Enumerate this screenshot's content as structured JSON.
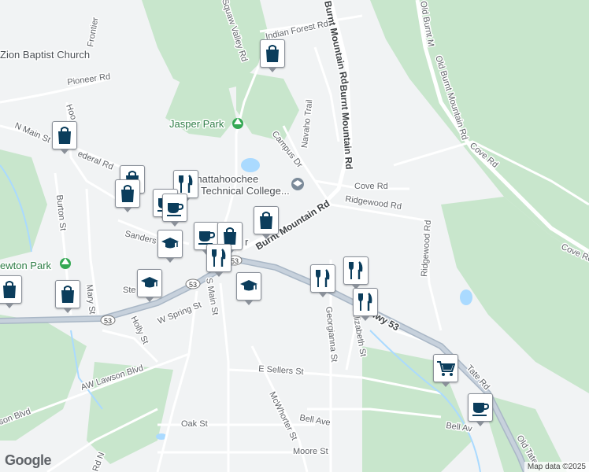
{
  "labels": {
    "church": "Zion Baptist Church",
    "jasper_park": "Jasper Park",
    "college_line1": "Chattahoochee",
    "college_line2": "Technical College...",
    "newton_park": "ewton Park",
    "frontier": "Frontier",
    "squaw_valley": "Squaw Valley Rd",
    "indian_forest": "Indian Forest Rd",
    "burnt_mtn_top": "Burnt Mountain Rd",
    "burnt_mtn_mid": "Burnt Mountain Rd",
    "burnt_mtn_diag": "Burnt Mountain Rd",
    "old_burnt_1": "Old Burnt M",
    "old_burnt_2": "Old Burnt Mountain Rd",
    "navaho": "Navaho Trail",
    "pioneer": "Pioneer Rd",
    "n_main": "N Main St",
    "federal": "ederal Rd",
    "hood": "Hoo",
    "campus": "Campus Dr",
    "cove": "Cove Rd",
    "cove_rd2": "Cove Rd",
    "cove_rd3": "Cove Ro",
    "ridgewood": "Ridgewood Rd",
    "ridgewood2": "Ridgewood Rd",
    "sanders": "Sanders S",
    "burton": "Burton St",
    "mary": "Mary St",
    "ste": "Ste",
    "s_main": "S Main St",
    "holly": "Holly St",
    "w_spring": "W Spring St",
    "georgianna": "Georgianna St",
    "elizabeth": "Elizabeth St",
    "hwy53": "Hwy 53",
    "tate": "Tate Rd",
    "old_tate": "Old Tate",
    "aw_lawson": "AW Lawson Blvd",
    "lawson_blvd": "son Blvd",
    "e_sellers": "E Sellers St",
    "mcwhorter": "McWhorter St",
    "bell_ave": "Bell Ave",
    "bell_av2": "Bell Av",
    "oak": "Oak St",
    "moore": "Moore St",
    "rd_n": "Rd N",
    "shield53a": "53",
    "shield53b": "53",
    "shield_town": "53",
    "town_partial": "r"
  },
  "footer": {
    "google": "Google",
    "attribution": "Map data ©2025"
  },
  "pins": [
    {
      "type": "shopping",
      "icon": "shopping-bag-icon"
    },
    {
      "type": "shopping",
      "icon": "shopping-bag-icon"
    },
    {
      "type": "shopping",
      "icon": "shopping-bag-icon"
    },
    {
      "type": "shopping",
      "icon": "shopping-bag-icon"
    },
    {
      "type": "restaurant",
      "icon": "fork-knife-icon"
    },
    {
      "type": "cafe",
      "icon": "coffee-cup-icon"
    },
    {
      "type": "cafe",
      "icon": "coffee-cup-icon"
    },
    {
      "type": "shopping",
      "icon": "shopping-bag-icon"
    },
    {
      "type": "school",
      "icon": "graduation-cap-icon"
    },
    {
      "type": "restaurant",
      "icon": "fork-knife-icon"
    },
    {
      "type": "school",
      "icon": "graduation-cap-icon"
    },
    {
      "type": "school",
      "icon": "graduation-cap-icon"
    },
    {
      "type": "shopping",
      "icon": "shopping-bag-icon"
    },
    {
      "type": "shopping",
      "icon": "shopping-bag-icon"
    },
    {
      "type": "restaurant",
      "icon": "fork-knife-icon"
    },
    {
      "type": "restaurant",
      "icon": "fork-knife-icon"
    },
    {
      "type": "restaurant",
      "icon": "fork-knife-icon"
    },
    {
      "type": "grocery",
      "icon": "shopping-cart-icon"
    },
    {
      "type": "cafe",
      "icon": "coffee-cup-icon"
    }
  ],
  "colors": {
    "park": "#a8dab5",
    "water": "#9fd7e6",
    "highway": "#a9b7c6",
    "pin_icon": "#0b3d5c"
  }
}
